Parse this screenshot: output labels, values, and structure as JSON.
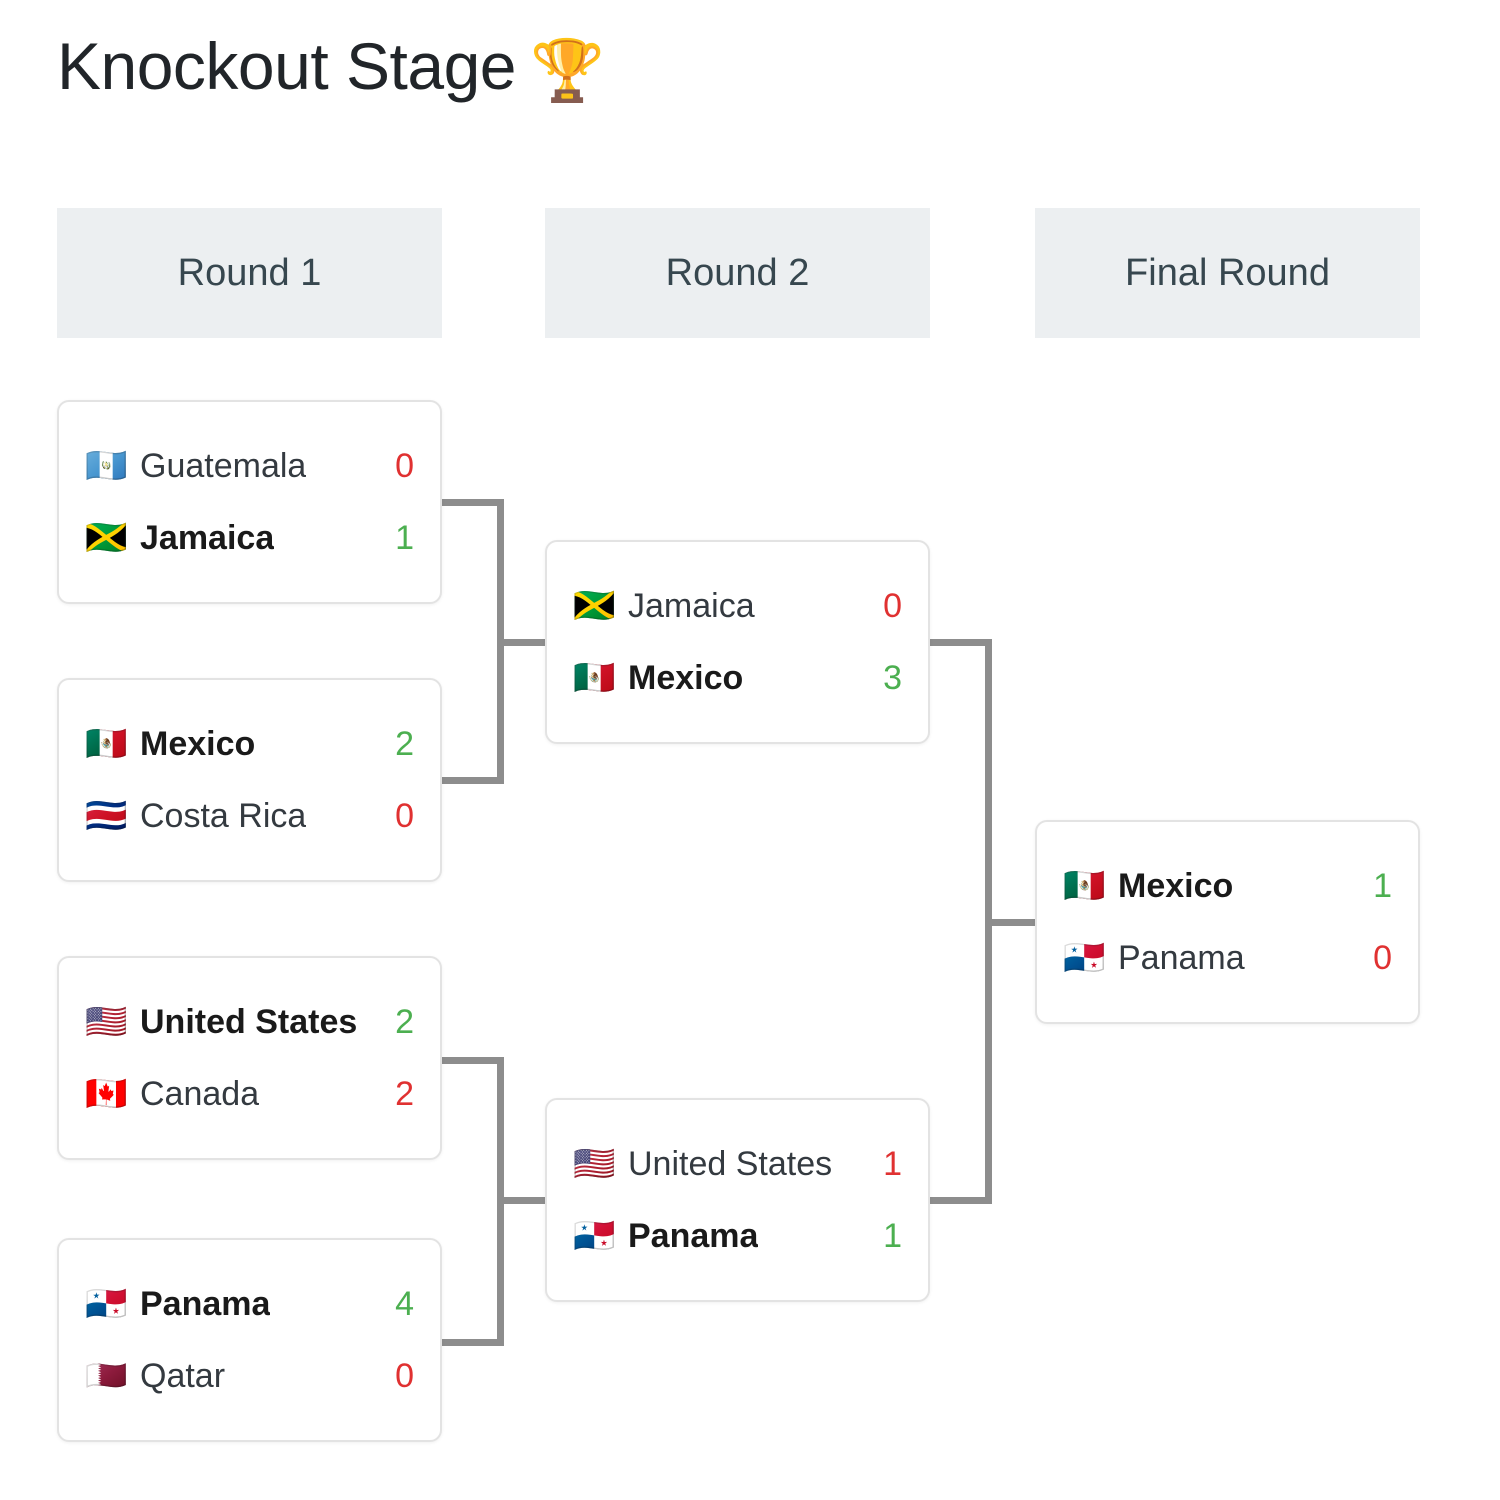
{
  "header": {
    "title": "Knockout Stage",
    "trophy_icon": "🏆"
  },
  "rounds": [
    {
      "label": "Round 1"
    },
    {
      "label": "Round 2"
    },
    {
      "label": "Final Round"
    }
  ],
  "colors": {
    "winner_score": "#4caf50",
    "loser_score": "#e03131",
    "round_header_bg": "#eceff1",
    "card_border": "#e3e3e3",
    "connector": "#8d8d8d",
    "page_bg": "#ffffff"
  },
  "bracket": {
    "round_1": {
      "label": "Round 1",
      "matches": [
        {
          "teams": [
            {
              "flag": "🇬🇹",
              "flag_name": "flag-guatemala",
              "name": "Guatemala",
              "score": "0",
              "winner": false
            },
            {
              "flag": "🇯🇲",
              "flag_name": "flag-jamaica",
              "name": "Jamaica",
              "score": "1",
              "winner": true
            }
          ]
        },
        {
          "teams": [
            {
              "flag": "🇲🇽",
              "flag_name": "flag-mexico",
              "name": "Mexico",
              "score": "2",
              "winner": true
            },
            {
              "flag": "🇨🇷",
              "flag_name": "flag-costa-rica",
              "name": "Costa Rica",
              "score": "0",
              "winner": false
            }
          ]
        },
        {
          "teams": [
            {
              "flag": "🇺🇸",
              "flag_name": "flag-united-states",
              "name": "United States",
              "score": "2",
              "winner": true
            },
            {
              "flag": "🇨🇦",
              "flag_name": "flag-canada",
              "name": "Canada",
              "score": "2",
              "winner": false
            }
          ]
        },
        {
          "teams": [
            {
              "flag": "🇵🇦",
              "flag_name": "flag-panama",
              "name": "Panama",
              "score": "4",
              "winner": true
            },
            {
              "flag": "🇶🇦",
              "flag_name": "flag-qatar",
              "name": "Qatar",
              "score": "0",
              "winner": false
            }
          ]
        }
      ]
    },
    "round_2": {
      "label": "Round 2",
      "matches": [
        {
          "teams": [
            {
              "flag": "🇯🇲",
              "flag_name": "flag-jamaica",
              "name": "Jamaica",
              "score": "0",
              "winner": false
            },
            {
              "flag": "🇲🇽",
              "flag_name": "flag-mexico",
              "name": "Mexico",
              "score": "3",
              "winner": true
            }
          ]
        },
        {
          "teams": [
            {
              "flag": "🇺🇸",
              "flag_name": "flag-united-states",
              "name": "United States",
              "score": "1",
              "winner": false
            },
            {
              "flag": "🇵🇦",
              "flag_name": "flag-panama",
              "name": "Panama",
              "score": "1",
              "winner": true
            }
          ]
        }
      ]
    },
    "final_round": {
      "label": "Final Round",
      "matches": [
        {
          "teams": [
            {
              "flag": "🇲🇽",
              "flag_name": "flag-mexico",
              "name": "Mexico",
              "score": "1",
              "winner": true
            },
            {
              "flag": "🇵🇦",
              "flag_name": "flag-panama",
              "name": "Panama",
              "score": "0",
              "winner": false
            }
          ]
        }
      ]
    }
  }
}
